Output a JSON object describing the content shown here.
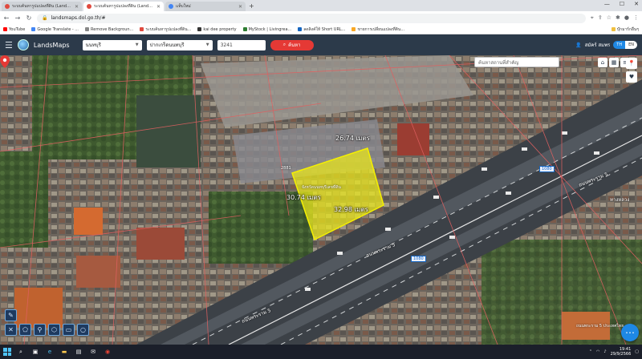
{
  "browser": {
    "tabs": [
      {
        "title": "ระบบค้นหารูปแปลงที่ดิน (LandsMap)",
        "active": false
      },
      {
        "title": "ระบบค้นหารูปแปลงที่ดิน (LandsMap)",
        "active": true
      },
      {
        "title": "แท็บใหม่",
        "active": false
      }
    ],
    "new_tab": "+",
    "url": "landsmaps.dol.go.th/#",
    "bookmarks": [
      "YouTube",
      "Google Translate - ...",
      "Remove Backgroun...",
      "ระบบค้นหารูปแปลงที่ดิน...",
      "kai dee property",
      "MyStock | Livingrea...",
      "ลดลิงค์ให้ Short URL...",
      "ขายการเปลี่ยนแปลงที่ดิน..."
    ],
    "bookmarks_right": "บุ๊กมาร์กอื่นๆ"
  },
  "app": {
    "name": "LandsMaps",
    "province": "นนทบุรี",
    "district": "ปากเกร็ดนนทบุรี",
    "parcel_no": "3241",
    "search_label": "ค้นหา",
    "user_name": "สมัคร์ สมพร",
    "lang_th": "TH",
    "lang_en": "EN"
  },
  "map": {
    "search_placeholder": "ค้นหาสถานที่สำคัญ",
    "dim_top": "26.74 เมตร",
    "dim_left": "30.74 เมตร",
    "dim_bottom": "32.98 เมตร",
    "plot_name": "จังหวัดนนทบุรีเลขที่ดิน",
    "plot_number": "2881",
    "road_label_1": "ถนนพระราม 5",
    "road_label_2": "ถนนพระราม 5",
    "road_label_3": "ถนนพระราม 5",
    "km_sign_1": "1080",
    "km_sign_2": "1080",
    "sign_top_right": "ทางหลวง",
    "watermark": "ถนนพระราม 5 ประเทศไทย"
  },
  "taskbar": {
    "time": "19:41",
    "date": "29/9/2566"
  },
  "colors": {
    "parcel_fill": "#e8e51e",
    "parcel_lines": "#e06060",
    "pin": "#e53935",
    "header": "#2c3a4a"
  }
}
